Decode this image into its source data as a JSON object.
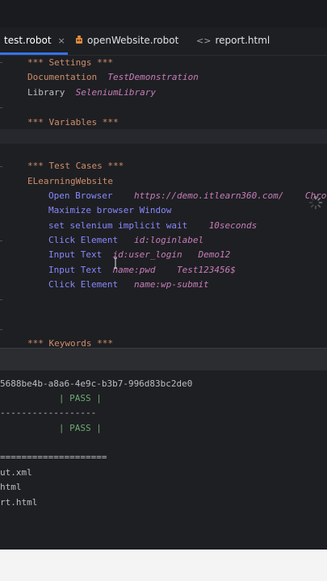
{
  "tabs": [
    {
      "label": "test.robot",
      "close": "×"
    },
    {
      "label": "openWebsite.robot"
    },
    {
      "label": "report.html",
      "icon": "<>"
    }
  ],
  "editor": {
    "settings_header": "*** Settings ***",
    "documentation_key": "Documentation",
    "documentation_value": "TestDemonstration",
    "library_key": "Library",
    "library_value": "SeleniumLibrary",
    "variables_header": "*** Variables ***",
    "testcases_header": "*** Test Cases ***",
    "test_name": "ELearningWebsite",
    "steps": [
      {
        "keyword": "Open Browser",
        "args": [
          "https://demo.itlearn360.com/",
          "Chro"
        ]
      },
      {
        "keyword": "Maximize browser Window",
        "args": []
      },
      {
        "keyword": "set selenium implicit wait",
        "args": [
          "10seconds"
        ]
      },
      {
        "keyword": "Click Element",
        "args": [
          "id:loginlabel"
        ]
      },
      {
        "keyword": "Input Text",
        "args": [
          "id:user_login",
          "Demo12"
        ]
      },
      {
        "keyword": "Input Text",
        "args": [
          "name:pwd",
          "Test123456$"
        ]
      },
      {
        "keyword": "Click Element",
        "args": [
          "name:wp-submit"
        ]
      }
    ],
    "keywords_header": "*** Keywords ***"
  },
  "console": {
    "lines": [
      "5688be4b-a8a6-4e9c-b3b7-996d83bc2de0",
      "           | PASS |",
      "------------------",
      "           | PASS |",
      "",
      "====================",
      "ut.xml",
      "html",
      "rt.html"
    ]
  },
  "colors": {
    "accent": "#3574f0",
    "pass": "#6aab73",
    "section": "#cf8e6d",
    "argument": "#c77dbb",
    "keyword": "#8888ff"
  }
}
